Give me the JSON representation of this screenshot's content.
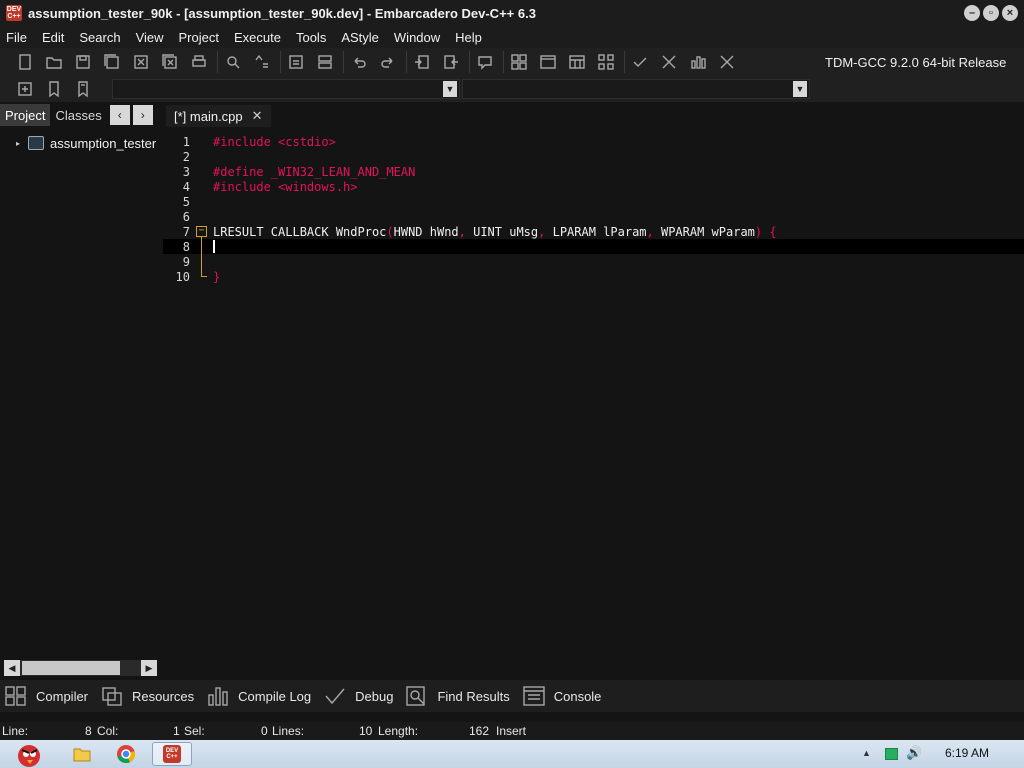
{
  "window": {
    "title": "assumption_tester_90k - [assumption_tester_90k.dev] - Embarcadero Dev-C++ 6.3",
    "app_icon_text": "DEV C++"
  },
  "menu": [
    "File",
    "Edit",
    "Search",
    "View",
    "Project",
    "Execute",
    "Tools",
    "AStyle",
    "Window",
    "Help"
  ],
  "toolbar": {
    "compiler": "TDM-GCC 9.2.0 64-bit Release",
    "icons": [
      "new-file-icon",
      "open-icon",
      "save-icon",
      "save-all-icon",
      "close-icon",
      "close-all-icon",
      "print-icon",
      "find-icon",
      "replace-icon",
      "goto-icon",
      "toggle-icon",
      "undo-icon",
      "redo-icon",
      "indent-icon",
      "unindent-icon",
      "comment-icon",
      "grid-icon",
      "window-icon",
      "table-icon",
      "tiles-icon",
      "check-icon",
      "stop-icon",
      "chart-icon",
      "cancel-icon"
    ]
  },
  "left_panel": {
    "tabs": [
      "Project",
      "Classes"
    ],
    "tree_item": "assumption_tester"
  },
  "editor": {
    "tab_label": "[*] main.cpp",
    "lines": [
      {
        "no": "1",
        "parts": [
          {
            "t": "#include <cstdio>",
            "c": "pp"
          }
        ]
      },
      {
        "no": "2",
        "parts": []
      },
      {
        "no": "3",
        "parts": [
          {
            "t": "#define _WIN32_LEAN_AND_MEAN",
            "c": "pp"
          }
        ]
      },
      {
        "no": "4",
        "parts": [
          {
            "t": "#include <windows.h>",
            "c": "pp"
          }
        ]
      },
      {
        "no": "5",
        "parts": []
      },
      {
        "no": "6",
        "parts": []
      },
      {
        "no": "7",
        "parts": [
          {
            "t": "LRESULT CALLBACK WndProc",
            "c": "id"
          },
          {
            "t": "(",
            "c": "pun"
          },
          {
            "t": "HWND hWnd",
            "c": "id"
          },
          {
            "t": ", ",
            "c": "pun"
          },
          {
            "t": "UINT uMsg",
            "c": "id"
          },
          {
            "t": ", ",
            "c": "pun"
          },
          {
            "t": "LPARAM lParam",
            "c": "id"
          },
          {
            "t": ", ",
            "c": "pun"
          },
          {
            "t": "WPARAM wParam",
            "c": "id"
          },
          {
            "t": ") {",
            "c": "pun"
          }
        ]
      },
      {
        "no": "8",
        "parts": []
      },
      {
        "no": "9",
        "parts": []
      },
      {
        "no": "10",
        "parts": [
          {
            "t": "}",
            "c": "pun"
          }
        ]
      }
    ],
    "current_line": 8
  },
  "bottom_tabs": [
    {
      "label": "Compiler",
      "icon": "grid-icon"
    },
    {
      "label": "Resources",
      "icon": "resources-icon"
    },
    {
      "label": "Compile Log",
      "icon": "chart-icon"
    },
    {
      "label": "Debug",
      "icon": "check-icon"
    },
    {
      "label": "Find Results",
      "icon": "find-icon"
    },
    {
      "label": "Console",
      "icon": "console-icon"
    }
  ],
  "status": {
    "line_label": "Line:",
    "line_value": "8",
    "col_label": "Col:",
    "col_value": "1",
    "sel_label": "Sel:",
    "sel_value": "0",
    "lines_label": "Lines:",
    "lines_value": "10",
    "length_label": "Length:",
    "length_value": "162",
    "mode": "Insert"
  },
  "taskbar": {
    "time": "6:19 AM"
  }
}
